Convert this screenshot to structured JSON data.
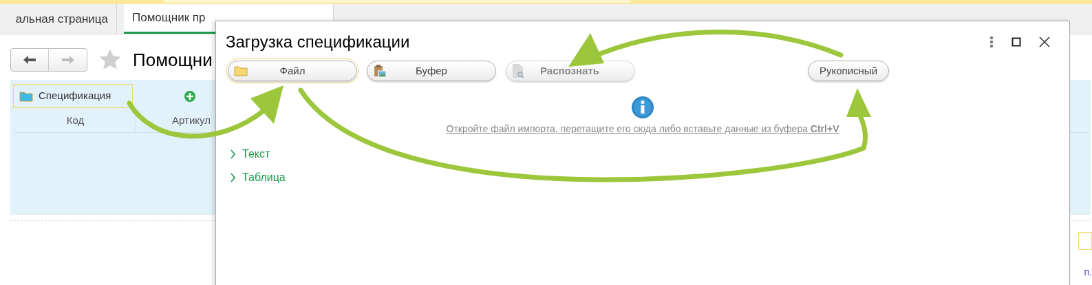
{
  "tabs": [
    {
      "label": "альная страница",
      "selected": false
    },
    {
      "label": "Помощник пр",
      "selected": true
    }
  ],
  "page": {
    "title": "Помощни",
    "nav": {
      "back_disabled": false,
      "forward_disabled": true
    },
    "spec_button": {
      "label": "Спецификация",
      "focused": true
    },
    "table": {
      "columns": [
        "Код",
        "Артикул"
      ]
    },
    "edge_link": "п."
  },
  "dialog": {
    "title": "Загрузка спецификации",
    "buttons": [
      {
        "kind": "file",
        "label": "Файл",
        "disabled": false,
        "focused": true
      },
      {
        "kind": "clipboard",
        "label": "Буфер",
        "disabled": false,
        "focused": false
      },
      {
        "kind": "recognize",
        "label": "Распознать",
        "disabled": true,
        "focused": false
      }
    ],
    "handwritten_button": {
      "label": "Рукописный"
    },
    "hint": "Откройте файл импорта, перетащите его сюда либо вставьте данные из буфера **Ctrl+V**",
    "groups": [
      {
        "label": "Текст",
        "expanded": false
      },
      {
        "label": "Таблица",
        "expanded": false
      }
    ]
  }
}
